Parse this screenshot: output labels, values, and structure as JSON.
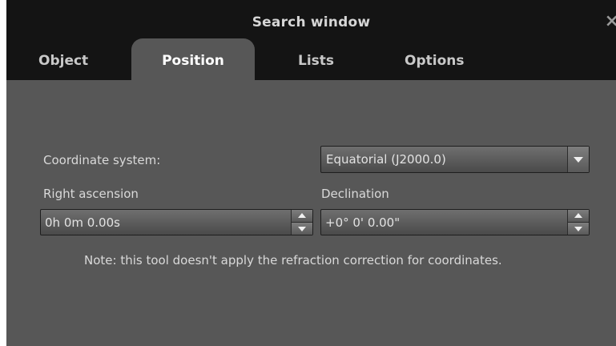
{
  "window": {
    "title": "Search window",
    "close_glyph": "×"
  },
  "tabs": [
    {
      "label": "Object",
      "active": false
    },
    {
      "label": "Position",
      "active": true
    },
    {
      "label": "Lists",
      "active": false
    },
    {
      "label": "Options",
      "active": false
    }
  ],
  "position": {
    "coordinate_system_label": "Coordinate system:",
    "coordinate_system_value": "Equatorial (J2000.0)",
    "right_ascension_label": "Right ascension",
    "right_ascension_value": "0h 0m 0.00s",
    "declination_label": "Declination",
    "declination_value": "+0° 0' 0.00\"",
    "note": "Note: this tool doesn't apply the refraction correction for coordinates."
  },
  "icons": {
    "close": "close-icon",
    "dropdown": "chevron-down-icon",
    "spin_up": "arrow-up-icon",
    "spin_down": "arrow-down-icon"
  },
  "colors": {
    "panel_background": "#575757",
    "titlebar_background": "#141414",
    "text": "#d9d9d9"
  }
}
